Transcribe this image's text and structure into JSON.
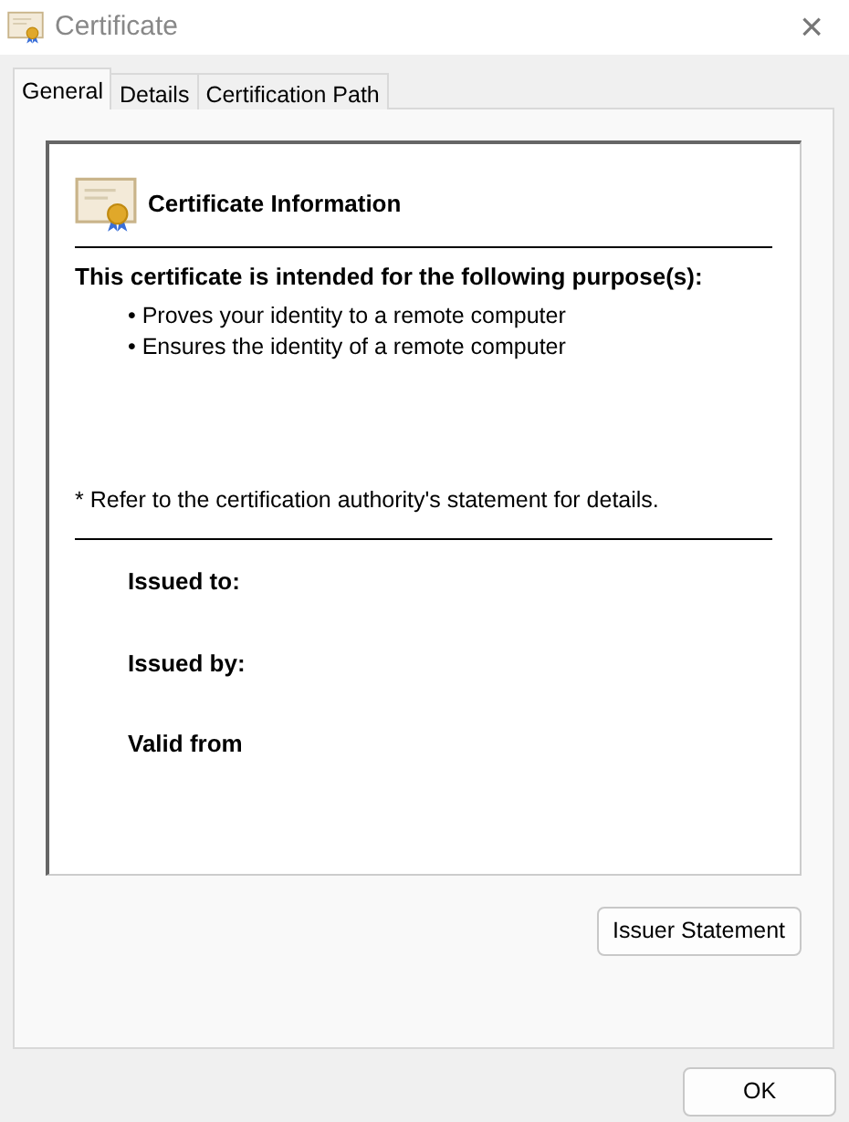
{
  "window": {
    "title": "Certificate",
    "close": "×"
  },
  "tabs": [
    {
      "label": "General",
      "selected": true
    },
    {
      "label": "Details",
      "selected": false
    },
    {
      "label": "Certification Path",
      "selected": false
    }
  ],
  "info": {
    "heading": "Certificate Information",
    "purpose_title": "This certificate is intended for the following purpose(s):",
    "purposes": [
      "• Proves your identity to a remote computer",
      "• Ensures the identity of a remote computer"
    ],
    "note": "* Refer to the certification authority's statement for details.",
    "fields": [
      "Issued to:",
      "Issued by:",
      "Valid from"
    ]
  },
  "issuer_button": "Issuer Statement",
  "buttons": [
    "OK"
  ]
}
